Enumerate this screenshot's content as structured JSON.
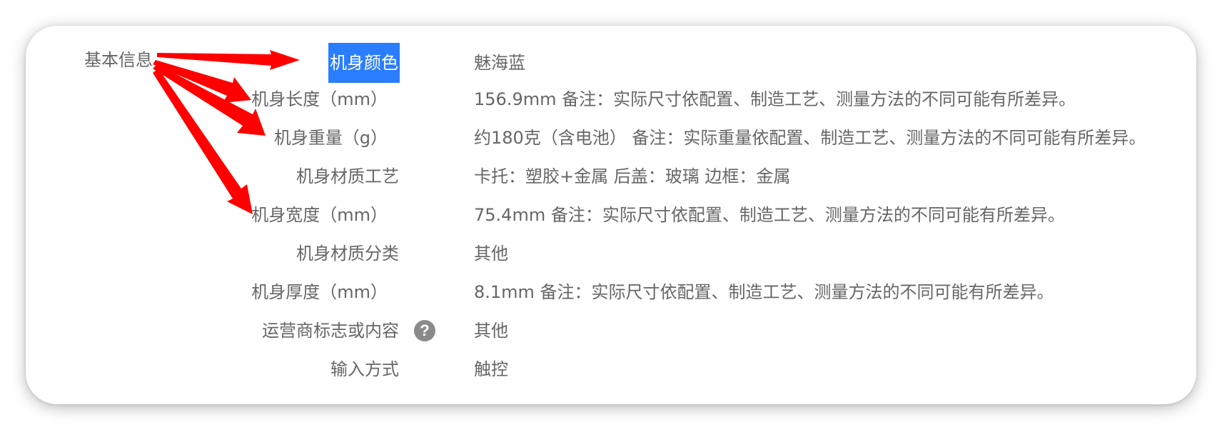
{
  "section": {
    "title": "基本信息"
  },
  "help_icon_glyph": "?",
  "arrow_color": "#ff0000",
  "highlight_color": "#2a7dff",
  "specs": [
    {
      "label": "机身颜色",
      "value": "魅海蓝"
    },
    {
      "label": "机身长度（mm）",
      "value": "156.9mm 备注：实际尺寸依配置、制造工艺、测量方法的不同可能有所差异。"
    },
    {
      "label": "机身重量（g）",
      "value": "约180克（含电池） 备注：实际重量依配置、制造工艺、测量方法的不同可能有所差异。"
    },
    {
      "label": "机身材质工艺",
      "value": "卡托：塑胶+金属 后盖：玻璃 边框：金属"
    },
    {
      "label": "机身宽度（mm）",
      "value": "75.4mm 备注：实际尺寸依配置、制造工艺、测量方法的不同可能有所差异。"
    },
    {
      "label": "机身材质分类",
      "value": "其他"
    },
    {
      "label": "机身厚度（mm）",
      "value": "8.1mm 备注：实际尺寸依配置、制造工艺、测量方法的不同可能有所差异。"
    },
    {
      "label": "运营商标志或内容",
      "value": "其他"
    },
    {
      "label": "输入方式",
      "value": "触控"
    }
  ]
}
